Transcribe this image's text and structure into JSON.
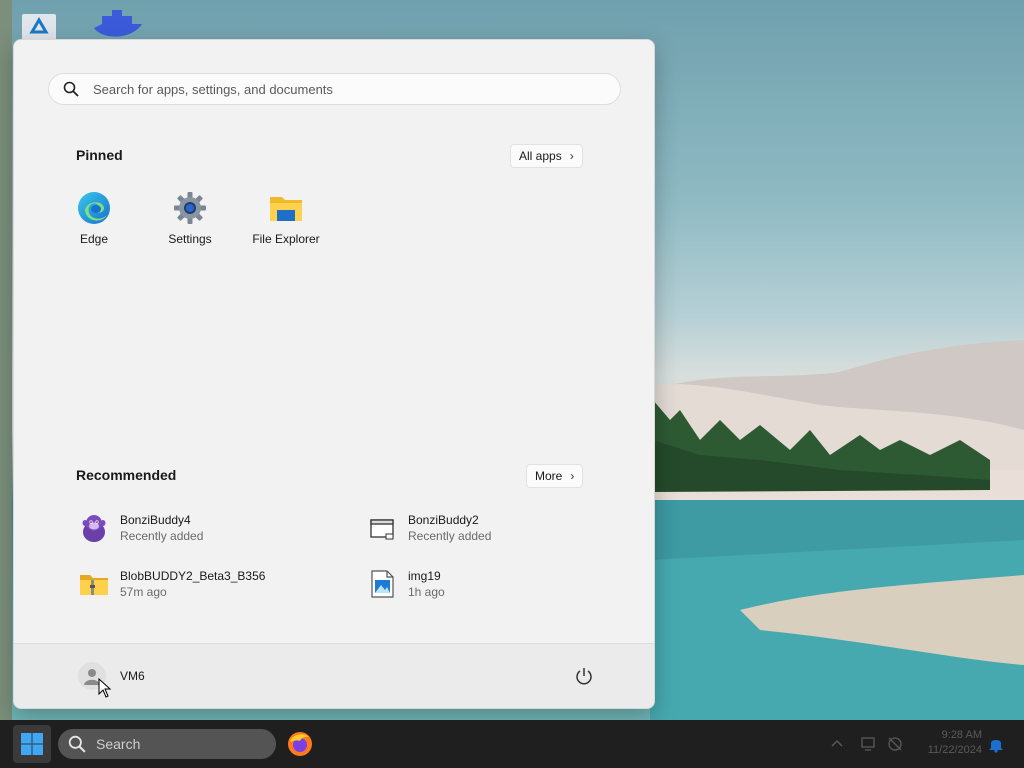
{
  "start_menu": {
    "search_placeholder": "Search for apps, settings, and documents",
    "pinned": {
      "title": "Pinned",
      "all_apps_label": "All apps",
      "items": [
        {
          "label": "Edge",
          "icon": "edge-icon"
        },
        {
          "label": "Settings",
          "icon": "gear-icon"
        },
        {
          "label": "File Explorer",
          "icon": "folder-icon"
        }
      ]
    },
    "recommended": {
      "title": "Recommended",
      "more_label": "More",
      "items": [
        {
          "name": "BonziBuddy4",
          "sub": "Recently added",
          "icon": "bonzi-icon"
        },
        {
          "name": "BonziBuddy2",
          "sub": "Recently added",
          "icon": "window-icon"
        },
        {
          "name": "BlobBUDDY2_Beta3_B356",
          "sub": "57m ago",
          "icon": "zip-folder-icon"
        },
        {
          "name": "img19",
          "sub": "1h ago",
          "icon": "image-file-icon"
        }
      ]
    },
    "user": {
      "name": "VM6",
      "icon": "user-avatar-icon"
    },
    "power_icon": "power-icon"
  },
  "taskbar": {
    "search_label": "Search",
    "start_icon": "windows-logo-icon",
    "apps": [
      {
        "icon": "firefox-icon"
      }
    ],
    "clock_time": "9:28 AM",
    "clock_date": "11/22/2024"
  },
  "colors": {
    "accent": "#0067c0",
    "taskbar_bg": "#1f1f1f",
    "menu_bg": "#f2f2f2"
  }
}
